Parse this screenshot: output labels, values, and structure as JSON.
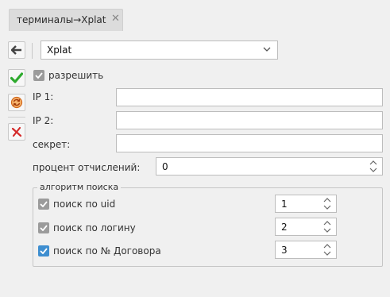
{
  "tab": {
    "title": "терминалы→Xplat",
    "close_glyph": "✕"
  },
  "toolbar": {
    "back_icon": "arrow-left-icon",
    "save_icon": "checkmark-icon",
    "refresh_icon": "refresh-icon",
    "cancel_icon": "cancel-x-icon"
  },
  "form": {
    "terminal_select": {
      "value": "Xplat"
    },
    "allow": {
      "label": "разрешить",
      "checked": true
    },
    "ip1": {
      "label": "IP 1:",
      "value": ""
    },
    "ip2": {
      "label": "IP 2:",
      "value": ""
    },
    "secret": {
      "label": "секрет:",
      "value": ""
    },
    "deduction_percent": {
      "label": "процент отчислений:",
      "value": "0"
    }
  },
  "search_algorithm": {
    "title": "алгоритм поиска",
    "items": [
      {
        "label": "поиск по uid",
        "checked": true,
        "style": "disabled",
        "order": "1"
      },
      {
        "label": "поиск по логину",
        "checked": true,
        "style": "disabled",
        "order": "2"
      },
      {
        "label": "поиск по № Договора",
        "checked": true,
        "style": "active",
        "order": "3"
      }
    ]
  },
  "colors": {
    "accent_blue": "#3e8ed0",
    "save_green": "#2eaa2e",
    "cancel_red": "#d42a2a",
    "refresh_orange": "#e07a1f"
  }
}
